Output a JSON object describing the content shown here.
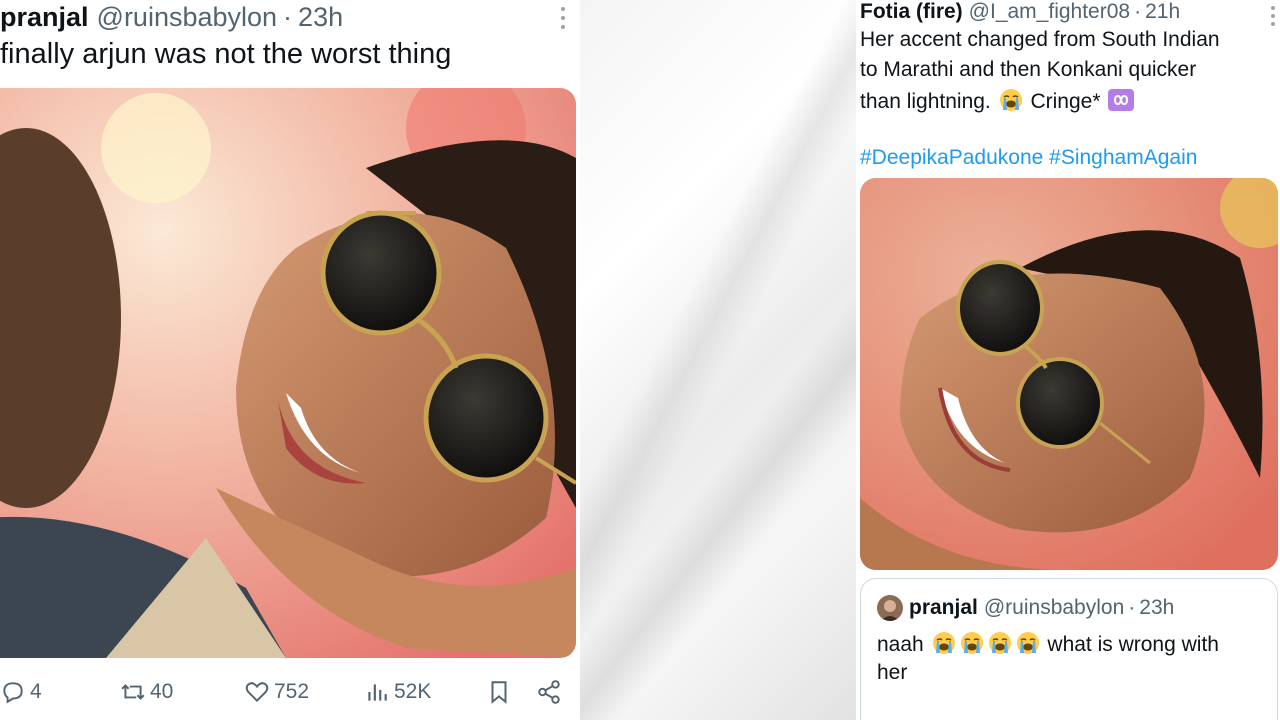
{
  "left_tweet": {
    "display_name": "pranjal",
    "handle": "@ruinsbabylon",
    "separator": "·",
    "time": "23h",
    "text": "finally arjun was not the worst thing",
    "actions": {
      "replies": "4",
      "retweets": "40",
      "likes": "752",
      "views": "52K"
    }
  },
  "right_tweet": {
    "display_name": "Fotia (fire)",
    "handle": "@I_am_fighter08",
    "separator": "·",
    "time": "21h",
    "text_line1": "Her accent changed from South Indian",
    "text_line2": "to Marathi and then Konkani quicker",
    "text_line3_start": "than lightning.",
    "text_line3_end": "Cringe*",
    "hashtags": [
      "#DeepikaPadukone",
      "#SinghamAgain"
    ],
    "quoted": {
      "display_name": "pranjal",
      "handle": "@ruinsbabylon",
      "separator": "·",
      "time": "23h",
      "text_line1_start": "naah",
      "text_line1_end": "what is wrong with",
      "text_line2": "her"
    }
  },
  "icons": {
    "reply": "reply-icon",
    "retweet": "retweet-icon",
    "like": "heart-icon",
    "views": "views-icon",
    "bookmark": "bookmark-icon",
    "share": "share-icon",
    "crying_emoji": "loudly-crying-face-emoji",
    "infinity_emoji": "infinity-emoji"
  },
  "colors": {
    "text": "#0f1419",
    "secondary": "#536471",
    "link": "#1d9bf0",
    "border": "#cfd9de"
  }
}
